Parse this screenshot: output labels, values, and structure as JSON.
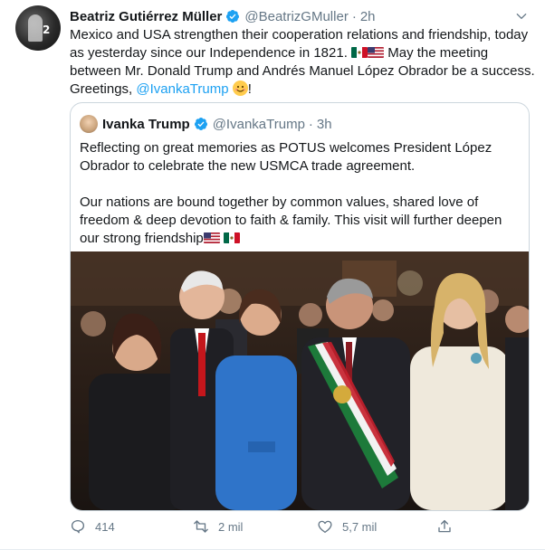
{
  "tweet": {
    "author_name": "Beatriz Gutiérrez Müller",
    "author_handle": "@BeatrizGMuller",
    "separator": "·",
    "time": "2h",
    "text_part1": "Mexico and USA strengthen their cooperation relations and friendship, today as yesterday since our Independence in 1821.",
    "text_part2": "May the meeting between Mr. Donald Trump and Andrés Manuel López Obrador be a success. Greetings,",
    "mention": "@IvankaTrump",
    "text_end": "!"
  },
  "quoted_tweet": {
    "author_name": "Ivanka Trump",
    "author_handle": "@IvankaTrump",
    "separator": "·",
    "time": "3h",
    "paragraph1": "Reflecting on great memories as POTUS welcomes President López Obrador to celebrate the new USMCA trade agreement.",
    "paragraph2": "Our nations are bound together by common values, shared love of freedom & deep devotion to faith & family. This visit will further deepen our strong friendship"
  },
  "actions": {
    "reply_count": "414",
    "retweet_count": "2 mil",
    "like_count": "5,7 mil"
  },
  "colors": {
    "accent": "#1da1f2",
    "secondary_text": "#657786",
    "border": "#ccd6dd"
  }
}
